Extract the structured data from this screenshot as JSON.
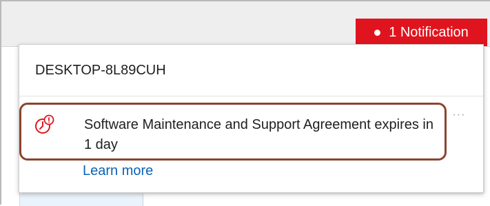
{
  "header": {
    "notification_button": "1 Notification"
  },
  "popup": {
    "device_name": "DESKTOP-8L89CUH",
    "notification": {
      "message": "Software Maintenance and Support Agreement expires in 1 day",
      "link_label": "Learn more",
      "more_label": "···",
      "icon": "clock-alert-icon"
    }
  },
  "colors": {
    "notification_red": "#e0141e",
    "highlight_border": "#8a4430",
    "link_blue": "#0a63b6"
  }
}
